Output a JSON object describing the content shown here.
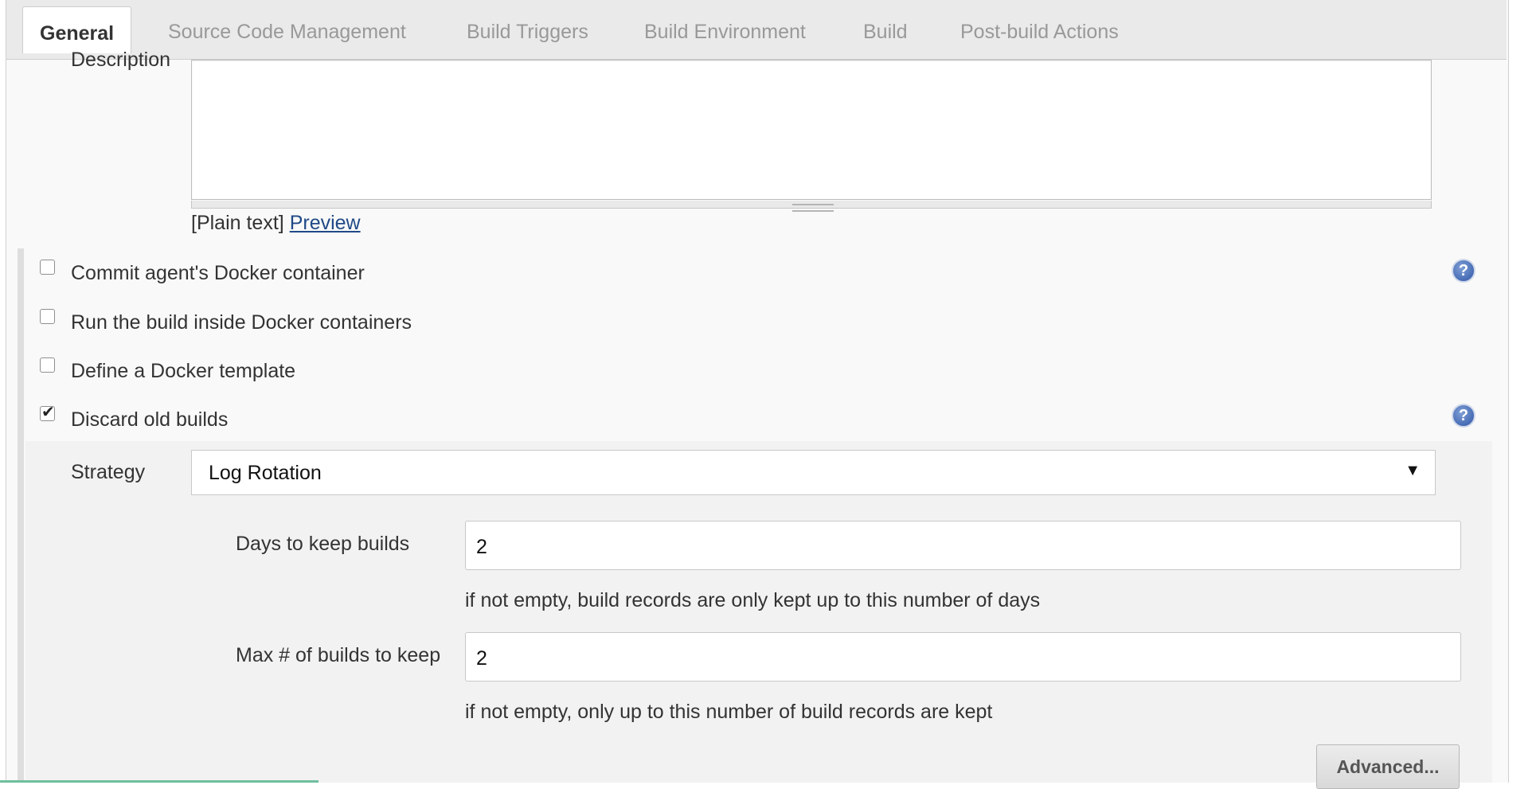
{
  "tabs": [
    {
      "label": "General",
      "active": true
    },
    {
      "label": "Source Code Management"
    },
    {
      "label": "Build Triggers"
    },
    {
      "label": "Build Environment"
    },
    {
      "label": "Build"
    },
    {
      "label": "Post-build Actions"
    }
  ],
  "description": {
    "label": "Description",
    "value": "",
    "markup_note": "[Plain text]",
    "preview_link": "Preview"
  },
  "options": [
    {
      "label": "Commit agent's Docker container",
      "checked": false,
      "help": true
    },
    {
      "label": "Run the build inside Docker containers",
      "checked": false
    },
    {
      "label": "Define a Docker template",
      "checked": false
    },
    {
      "label": "Discard old builds",
      "checked": true,
      "help": true
    }
  ],
  "discard": {
    "strategy_label": "Strategy",
    "strategy_value": "Log Rotation",
    "days_label": "Days to keep builds",
    "days_value": "2",
    "days_hint": "if not empty, build records are only kept up to this number of days",
    "max_label": "Max # of builds to keep",
    "max_value": "2",
    "max_hint": "if not empty, only up to this number of build records are kept",
    "advanced_label": "Advanced..."
  },
  "icons": {
    "help": "help-icon",
    "dropdown": "chevron-down-icon",
    "check": "check-icon"
  },
  "colors": {
    "link": "#204a87",
    "help": "#2f56a6",
    "tabbar": "#eaeaea"
  }
}
